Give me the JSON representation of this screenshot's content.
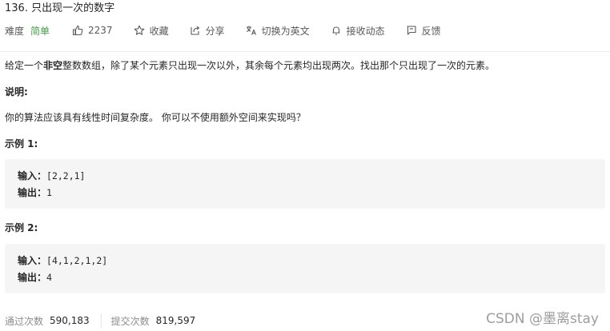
{
  "problem": {
    "title": "136. 只出现一次的数字"
  },
  "toolbar": {
    "difficulty_label": "难度",
    "difficulty_value": "简单",
    "likes": "2237",
    "favorite_label": "收藏",
    "share_label": "分享",
    "switch_lang_label": "切换为英文",
    "notify_label": "接收动态",
    "feedback_label": "反馈"
  },
  "description": {
    "part1": "给定一个",
    "bold": "非空",
    "part2": "整数数组，除了某个元素只出现一次以外，其余每个元素均出现两次。找出那个只出现了一次的元素。"
  },
  "note": {
    "title": "说明:",
    "text": "你的算法应该具有线性时间复杂度。 你可以不使用额外空间来实现吗？"
  },
  "examples": [
    {
      "title": "示例 1:",
      "input_label": "输入：",
      "input_value": "[2,2,1]",
      "output_label": "输出：",
      "output_value": "1"
    },
    {
      "title": "示例 2:",
      "input_label": "输入：",
      "input_value": "[4,1,2,1,2]",
      "output_label": "输出：",
      "output_value": "4"
    }
  ],
  "stats": {
    "accepted_label": "通过次数",
    "accepted_value": "590,183",
    "submissions_label": "提交次数",
    "submissions_value": "819,597"
  },
  "watermark": "CSDN @墨离stay",
  "colors": {
    "easy": "#43a047",
    "code_bg": "#f5f5f5",
    "muted": "#8c8c8c"
  },
  "icons": [
    "thumbs-up-icon",
    "star-icon",
    "share-icon",
    "translate-icon",
    "bell-icon",
    "feedback-icon"
  ]
}
